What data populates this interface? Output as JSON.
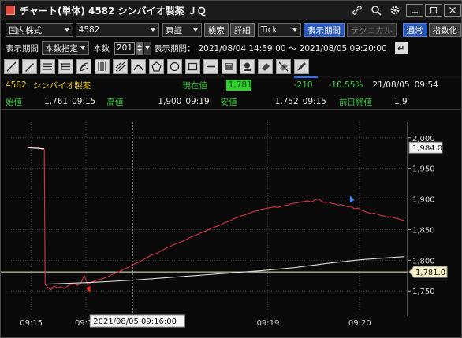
{
  "window": {
    "title": "チャート(単体) 4582 シンバイオ製薬 ＪＱ",
    "icons": [
      "link-icon",
      "search-icon",
      "gear-icon",
      "minimize-icon",
      "restore-icon",
      "close-icon"
    ]
  },
  "toolbar": {
    "market_type": "国内株式",
    "code": "4582",
    "exchange": "東証",
    "search_label": "検索",
    "detail_label": "詳細",
    "interval": "Tick",
    "display_period_label": "表示期間",
    "technical_label": "テクニカル",
    "normal_label": "通常",
    "index_label": "指数化"
  },
  "period_row": {
    "label": "表示期間",
    "mode": "本数指定",
    "count_label": "本数",
    "count_value": "201",
    "period_label": "表示期間：",
    "period_value": "2021/08/04 14:59:00 〜 2021/08/05 09:20:00"
  },
  "drawing_tools": [
    "trendline-tool",
    "pen-tool",
    "horizontal-lines-tool",
    "vertical-lines-tool",
    "fan-tool",
    "multi-vertical-tool",
    "hatched-tool",
    "arc-tool",
    "pentagon-tool",
    "circle-tool",
    "rectangle-tool",
    "hline-tool",
    "text-tool",
    "icon-tool",
    "eraser-tool",
    "delete-tool",
    "edit-tool"
  ],
  "quote": {
    "code": "4582",
    "name": "シンバイオ製薬",
    "current_label": "現在値",
    "current_value": "1,781",
    "change": "-210",
    "change_pct": "-10.55%",
    "date": "21/08/05",
    "time": "09:54"
  },
  "ohlc": {
    "open_label": "始値",
    "open_value": "1,761",
    "open_time": "09:15",
    "high_label": "高値",
    "high_value": "1,900",
    "high_time": "09:19",
    "low_label": "安値",
    "low_value": "1,752",
    "low_time": "09:15",
    "prev_label": "前日終値",
    "prev_value": "1,9"
  },
  "chart_data": {
    "type": "line",
    "y_ticks": [
      "2,000",
      "1,950",
      "1,900",
      "1,850",
      "1,800",
      "1,750"
    ],
    "ylim": [
      1740,
      2010
    ],
    "x_ticks": [
      "09:15",
      "09:16",
      "09:19",
      "09:20"
    ],
    "price_marker_top": "1,984.0",
    "price_marker_current": "1,781.0",
    "cursor_label": "2021/08/05 09:16:00",
    "colors": {
      "price": "#d2354a",
      "average": "#dcdcdc",
      "hline": "#f5f0c8",
      "grid": "#5a5a5a"
    },
    "series": [
      {
        "name": "price",
        "x": [
          0,
          0.2,
          0.4,
          0.6,
          0.8,
          1.0,
          1.05,
          1.2,
          1.4,
          1.6,
          1.8,
          2.0,
          2.2,
          2.5,
          2.8,
          3.0,
          3.2,
          3.4,
          3.5,
          3.6,
          3.8,
          4.0,
          4.2,
          4.5,
          4.8,
          5.0,
          5.2,
          5.4,
          5.6,
          5.8,
          6.0,
          6.2,
          6.4,
          6.6,
          6.8,
          7.0,
          7.2,
          7.4,
          7.6,
          7.8,
          8.0,
          8.2,
          8.4,
          8.6,
          8.8,
          9.0,
          9.2,
          9.4,
          9.6,
          9.8,
          10.0,
          10.2,
          10.4,
          10.6,
          10.8,
          11.0,
          11.2,
          11.4,
          11.6,
          11.8,
          12.0,
          12.2,
          12.4,
          12.6,
          12.8,
          13.0,
          13.2,
          13.4,
          13.6,
          13.8,
          14.0,
          14.2,
          14.4,
          14.6,
          14.8,
          15.0,
          15.2,
          15.4,
          15.6,
          15.8,
          16.0,
          16.2,
          16.4,
          16.6,
          16.8,
          17.0,
          17.2,
          17.4,
          17.6,
          17.8,
          18.0,
          18.2,
          18.4,
          18.6,
          18.8,
          19.0,
          19.2,
          19.4,
          19.5,
          19.6,
          19.8,
          20.0,
          20.2,
          20.4,
          20.6,
          20.8,
          21.0,
          21.2,
          21.4,
          21.6,
          21.8,
          22.0,
          22.2,
          22.4,
          22.6
        ],
        "values": [
          1984,
          1985,
          1983,
          1984,
          1982,
          1980,
          1761,
          1756,
          1752,
          1758,
          1755,
          1757,
          1754,
          1760,
          1762,
          1759,
          1763,
          1775,
          1768,
          1760,
          1764,
          1766,
          1768,
          1770,
          1773,
          1776,
          1778,
          1780,
          1783,
          1786,
          1788,
          1791,
          1794,
          1796,
          1799,
          1802,
          1805,
          1808,
          1810,
          1812,
          1815,
          1818,
          1821,
          1823,
          1826,
          1828,
          1830,
          1832,
          1835,
          1838,
          1840,
          1842,
          1845,
          1847,
          1849,
          1852,
          1854,
          1856,
          1858,
          1861,
          1863,
          1865,
          1868,
          1870,
          1872,
          1874,
          1876,
          1878,
          1880,
          1881,
          1883,
          1884,
          1885,
          1886,
          1887,
          1886,
          1888,
          1889,
          1890,
          1892,
          1893,
          1894,
          1895,
          1896,
          1897,
          1895,
          1898,
          1900,
          1897,
          1894,
          1895,
          1893,
          1892,
          1890,
          1891,
          1889,
          1887,
          1888,
          1886,
          1884,
          1885,
          1882,
          1880,
          1878,
          1876,
          1877,
          1875,
          1873,
          1872,
          1870,
          1871,
          1869,
          1868,
          1866,
          1865
        ]
      },
      {
        "name": "average",
        "x": [
          1.05,
          2,
          4,
          6,
          8,
          10,
          12,
          14,
          16,
          18,
          20,
          22.6
        ],
        "values": [
          1761,
          1762,
          1764,
          1767,
          1771,
          1775,
          1779,
          1783,
          1788,
          1795,
          1801,
          1806
        ]
      }
    ]
  }
}
